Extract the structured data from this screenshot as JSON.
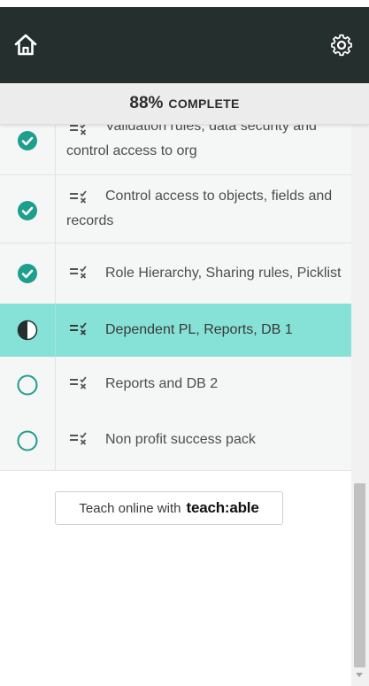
{
  "header": {
    "home_icon": "home-icon",
    "settings_icon": "gear-icon",
    "background": "#25302e"
  },
  "progress": {
    "percent": "88%",
    "label": "COMPLETE",
    "value": 0.88
  },
  "lessons": [
    {
      "title": "Validation rules, data security and control access to org",
      "status": "complete"
    },
    {
      "title": "Control access to objects, fields and records",
      "status": "complete"
    },
    {
      "title": "Role Hierarchy, Sharing rules, Picklist",
      "status": "complete"
    },
    {
      "title": "Dependent PL, Reports, DB 1",
      "status": "in-progress"
    },
    {
      "title": "Reports and DB 2",
      "status": "not-started"
    },
    {
      "title": "Non profit success pack",
      "status": "not-started"
    }
  ],
  "footer_badge": {
    "text": "Teach online with",
    "brand": "teach:able"
  },
  "colors": {
    "accent": "#1e9e8c",
    "active_row": "#86e1d6"
  }
}
